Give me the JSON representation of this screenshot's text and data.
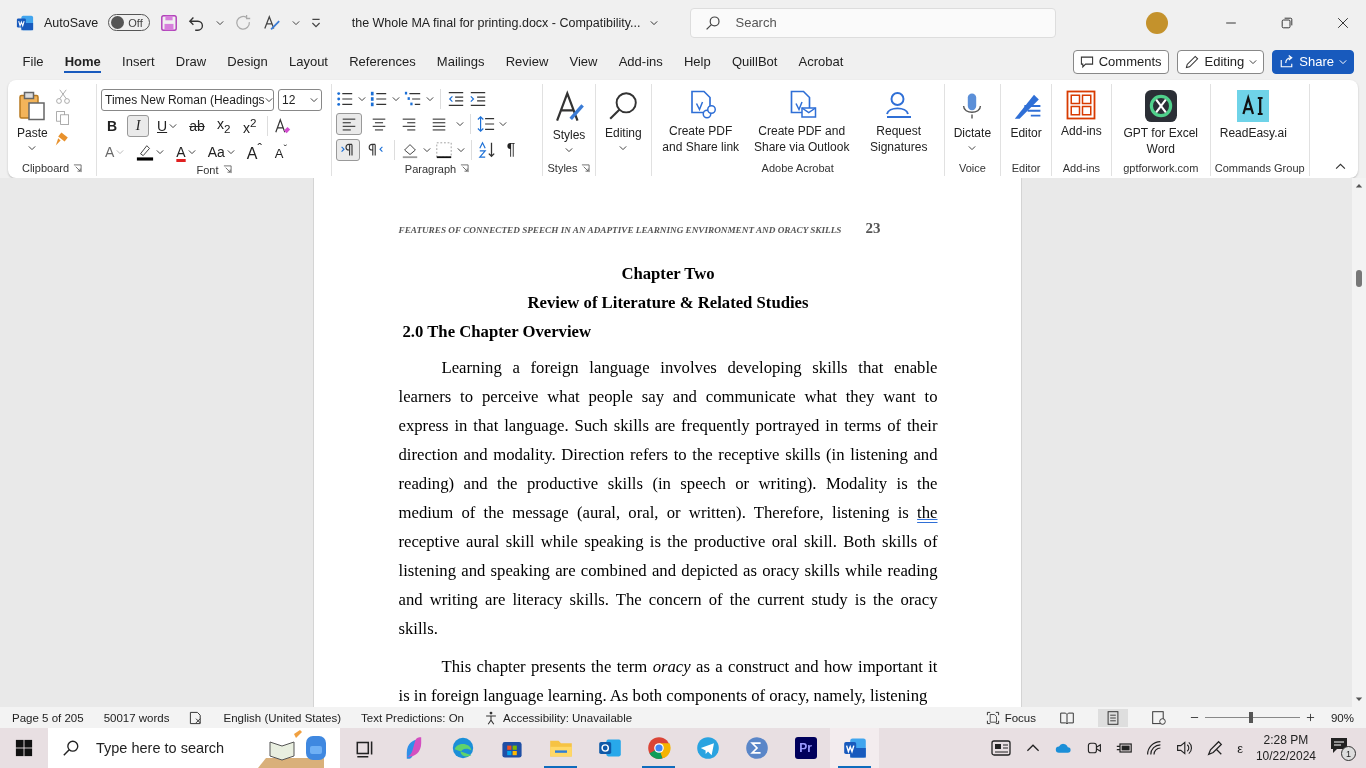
{
  "title_bar": {
    "autosave_label": "AutoSave",
    "autosave_on": false,
    "autosave_state": "Off",
    "doc_title": "the Whole MA final for printing.docx  -  Compatibility...",
    "search": {
      "placeholder": "Search"
    }
  },
  "menu_tabs": [
    {
      "label": "File",
      "selected": false
    },
    {
      "label": "Home",
      "selected": true
    },
    {
      "label": "Insert",
      "selected": false
    },
    {
      "label": "Draw",
      "selected": false
    },
    {
      "label": "Design",
      "selected": false
    },
    {
      "label": "Layout",
      "selected": false
    },
    {
      "label": "References",
      "selected": false
    },
    {
      "label": "Mailings",
      "selected": false
    },
    {
      "label": "Review",
      "selected": false
    },
    {
      "label": "View",
      "selected": false
    },
    {
      "label": "Add-ins",
      "selected": false
    },
    {
      "label": "Help",
      "selected": false
    },
    {
      "label": "QuillBot",
      "selected": false
    },
    {
      "label": "Acrobat",
      "selected": false
    }
  ],
  "actions": {
    "comments": "Comments",
    "editing": "Editing",
    "share": "Share"
  },
  "ribbon": {
    "clipboard": {
      "paste": "Paste",
      "label": "Clipboard"
    },
    "font": {
      "font_name": "Times New Roman (Headings",
      "font_size": "12",
      "label": "Font",
      "format_buttons": [
        {
          "label": "B",
          "kind": "bold",
          "selected": false,
          "dropdown": false
        },
        {
          "label": "I",
          "kind": "italic",
          "selected": true,
          "dropdown": false
        },
        {
          "label": "U",
          "kind": "underline",
          "selected": false,
          "dropdown": true
        },
        {
          "label": "ab",
          "kind": "strike",
          "selected": false,
          "dropdown": false
        },
        {
          "label": "x$_{2}$",
          "kind": "subscript",
          "selected": false,
          "dropdown": false
        },
        {
          "label": "x$^{2}$",
          "kind": "superscript",
          "selected": false,
          "dropdown": false
        }
      ],
      "tools": [
        {
          "label": "A",
          "kind": "effects",
          "dropdown": true,
          "disabled": true
        },
        {
          "kind": "highlight",
          "dropdown": true,
          "disabled": false
        },
        {
          "label": "A",
          "kind": "color",
          "dropdown": true,
          "disabled": false
        },
        {
          "label": "Aa",
          "kind": "case",
          "dropdown": true,
          "disabled": false
        },
        {
          "label": "A$^{ˆ}$",
          "kind": "grow",
          "dropdown": false,
          "disabled": false
        },
        {
          "label": "A$^{ˇ}$",
          "kind": "shrink",
          "dropdown": false,
          "disabled": false
        }
      ]
    },
    "paragraph": {
      "label": "Paragraph",
      "pilcrow": "¶",
      "alignment": [
        {
          "kind": "left",
          "selected": true
        },
        {
          "kind": "center",
          "selected": false
        },
        {
          "kind": "right",
          "selected": false
        },
        {
          "kind": "justify",
          "selected": false
        }
      ],
      "direction": [
        {
          "kind": "ltr",
          "selected": true
        },
        {
          "kind": "rtl",
          "selected": false
        }
      ]
    },
    "groups": [
      {
        "label": "Styles",
        "launcher": true,
        "buttons": [
          {
            "label": "Styles",
            "kind": "styles",
            "dropdown": true
          }
        ]
      },
      {
        "launcher": false,
        "buttons": [
          {
            "label": "Editing",
            "kind": "find",
            "dropdown": true
          }
        ]
      },
      {
        "label": "Adobe Acrobat",
        "launcher": false,
        "buttons": [
          {
            "label": "Create PDF and Share link",
            "kind": "pdf-link",
            "dropdown": false
          },
          {
            "label": "Create PDF and Share via Outlook",
            "kind": "pdf-mail",
            "dropdown": false
          },
          {
            "label": "Request Signatures",
            "kind": "signature",
            "dropdown": false
          }
        ]
      },
      {
        "label": "Voice",
        "launcher": false,
        "buttons": [
          {
            "label": "Dictate",
            "kind": "mic",
            "dropdown": true
          }
        ]
      },
      {
        "label": "Editor",
        "launcher": false,
        "buttons": [
          {
            "label": "Editor",
            "kind": "editor",
            "dropdown": false
          }
        ]
      },
      {
        "label": "Add-ins",
        "launcher": false,
        "buttons": [
          {
            "label": "Add-ins",
            "kind": "addins",
            "dropdown": false
          }
        ]
      },
      {
        "label": "gptforwork.com",
        "launcher": false,
        "buttons": [
          {
            "label": "GPT for Excel Word",
            "kind": "gpt",
            "dropdown": false
          }
        ]
      },
      {
        "label": "Commands Group",
        "launcher": false,
        "buttons": [
          {
            "label": "ReadEasy.ai",
            "kind": "readeasy",
            "dropdown": false
          }
        ]
      }
    ]
  },
  "document": {
    "header": "FEATURES OF CONNECTED SPEECH IN AN ADAPTIVE LEARNING ENVIRONMENT AND ORACY SKILLS",
    "page_number": "23",
    "headings": [
      {
        "text": "Chapter Two",
        "kind": "center"
      },
      {
        "text": "Review of Literature & Related Studies",
        "kind": "center"
      },
      {
        "text": "2.0 The Chapter Overview",
        "kind": "left"
      }
    ],
    "paragraphs": [
      {
        "segments": [
          {
            "text": "Learning a foreign language involves developing skills that enable learners to perceive what people say and communicate what they want to express in that language. Such skills are frequently portrayed in terms of their direction and modality. Direction refers to the receptive skills (in listening and reading) and the productive skills (in speech or writing). Modality is the medium of the message (aural, oral, or written). Therefore, listening is ",
            "flagged": false
          },
          {
            "text": "the",
            "flagged": true
          },
          {
            "text": " receptive aural skill while speaking is the productive oral skill. Both skills of listening and speaking are combined and depicted as oracy skills while reading and writing are literacy skills. The concern of the current study is the oracy skills.",
            "flagged": false
          }
        ]
      },
      {
        "segments": [
          {
            "text": "This chapter presents the term *oracy* as a construct and how important it is in foreign language learning. As both components of oracy, namely, listening",
            "flagged": false
          }
        ]
      }
    ]
  },
  "status_bar": {
    "page": "Page 5 of 205",
    "words": "50017 words",
    "language": "English (United States)",
    "predictions": "Text Predictions: On",
    "accessibility": "Accessibility: Unavailable",
    "focus": "Focus",
    "views": [
      {
        "kind": "read",
        "selected": false
      },
      {
        "kind": "print",
        "selected": true
      },
      {
        "kind": "web",
        "selected": false
      }
    ],
    "zoom": {
      "level": 0.48,
      "reading": "90%"
    }
  },
  "taskbar": {
    "search": {
      "placeholder": "Type here to search"
    },
    "apps": [
      {
        "kind": "taskview",
        "running": false
      },
      {
        "kind": "copilot",
        "running": false
      },
      {
        "kind": "edge",
        "running": false
      },
      {
        "kind": "store",
        "running": false
      },
      {
        "kind": "explorer",
        "running": true
      },
      {
        "kind": "outlook",
        "running": false
      },
      {
        "kind": "chrome",
        "running": true
      },
      {
        "kind": "telegram",
        "running": false
      },
      {
        "kind": "math",
        "running": false
      },
      {
        "kind": "premiere",
        "running": false,
        "label": "Pr"
      },
      {
        "kind": "word",
        "running": true
      }
    ],
    "ime": "ε",
    "time": "2:28 PM",
    "date": "10/22/2024",
    "notifications": "1"
  }
}
